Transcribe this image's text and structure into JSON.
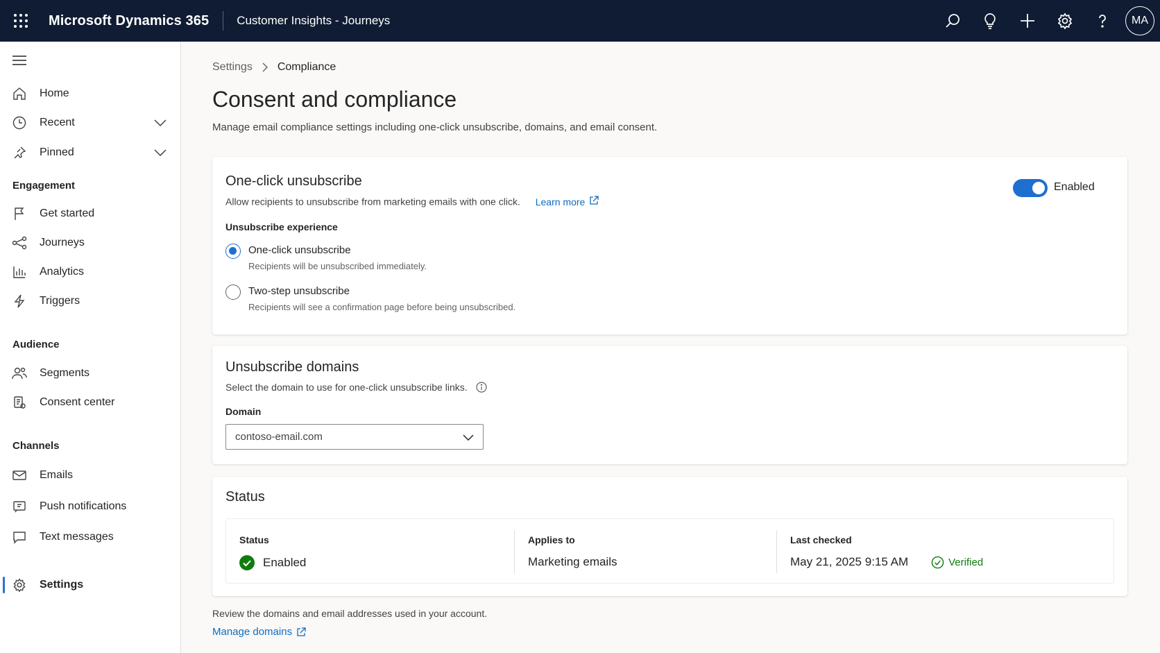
{
  "header": {
    "app_title": "Microsoft Dynamics 365",
    "module_title": "Customer Insights - Journeys",
    "avatar_initials": "MA",
    "icons": [
      "app-launcher-icon",
      "search-icon",
      "lightbulb-icon",
      "plus-icon",
      "settings-icon",
      "help-icon"
    ]
  },
  "sidebar": {
    "items_top": [
      {
        "label": "Home",
        "icon": "home-icon"
      },
      {
        "label": "Recent",
        "icon": "clock-icon"
      },
      {
        "label": "Pinned",
        "icon": "pin-icon"
      }
    ],
    "sections": {
      "engagement": "Engagement",
      "audience": "Audience",
      "channels": "Channels"
    },
    "engagement_items": [
      {
        "label": "Get started",
        "icon": "flag-icon"
      },
      {
        "label": "Journeys",
        "icon": "journey-icon"
      },
      {
        "label": "Analytics",
        "icon": "analytics-icon"
      },
      {
        "label": "Triggers",
        "icon": "lightning-icon"
      }
    ],
    "audience_items": [
      {
        "label": "Segments",
        "icon": "people-icon"
      },
      {
        "label": "Consent center",
        "icon": "consent-icon"
      }
    ],
    "channel_items": [
      {
        "label": "Emails",
        "icon": "mail-icon"
      },
      {
        "label": "Push notifications",
        "icon": "push-icon"
      },
      {
        "label": "Text messages",
        "icon": "chat-icon"
      }
    ],
    "settings": {
      "label": "Settings",
      "icon": "settings-icon",
      "active": true
    }
  },
  "breadcrumb": {
    "parent": "Settings",
    "current": "Compliance"
  },
  "page": {
    "title": "Consent and compliance",
    "description": "Manage email compliance settings including one-click unsubscribe, domains, and email consent."
  },
  "unsubscribe_card": {
    "title": "One-click unsubscribe",
    "description": "Allow recipients to unsubscribe from marketing emails with one click.",
    "learn_more": "Learn more",
    "toggle_label": "Enabled",
    "toggle_on": true,
    "experience_label": "Unsubscribe experience",
    "options": [
      {
        "label": "One-click unsubscribe",
        "sub": "Recipients will be unsubscribed immediately.",
        "checked": true
      },
      {
        "label": "Two-step unsubscribe",
        "sub": "Recipients will see a confirmation page before being unsubscribed.",
        "checked": false
      }
    ]
  },
  "domains_card": {
    "title": "Unsubscribe domains",
    "description": "Select the domain to use for one-click unsubscribe links.",
    "domain_label": "Domain",
    "domain_value": "contoso-email.com"
  },
  "status_card": {
    "title": "Status",
    "status_head": "Status",
    "status_value": "Enabled",
    "applies_head": "Applies to",
    "applies_value": "Marketing emails",
    "checked_head": "Last checked",
    "checked_value": "May 21, 2025 9:15 AM",
    "verified_label": "Verified"
  },
  "footer": {
    "text": "Review the domains and email addresses used in your account.",
    "link": "Manage domains"
  },
  "colors": {
    "header_bg": "#0f1c33",
    "accent": "#1e6fd0",
    "link": "#0f6cbd",
    "success": "#107c10"
  }
}
